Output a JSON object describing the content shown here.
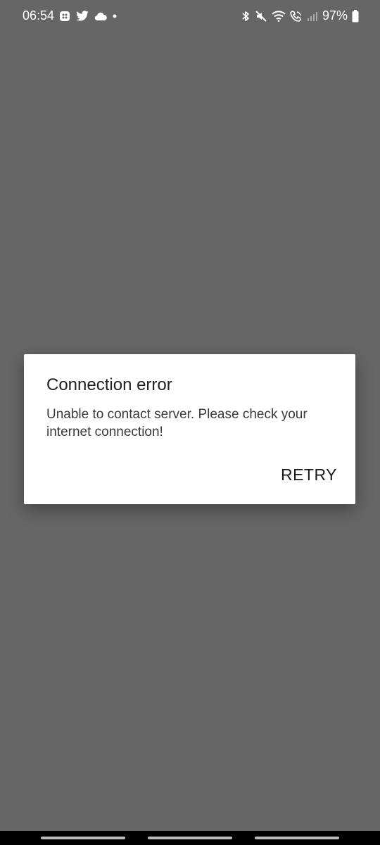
{
  "status_bar": {
    "time": "06:54",
    "battery_percent": "97%",
    "left_icons": [
      "dots-app-icon",
      "twitter-icon",
      "cloud-icon",
      "notification-dot-icon"
    ],
    "right_icons": [
      "bluetooth-icon",
      "mute-icon",
      "wifi-icon",
      "wifi-calling-icon",
      "signal-icon",
      "battery-icon"
    ]
  },
  "dialog": {
    "title": "Connection error",
    "message": "Unable to contact server. Please check your internet connection!",
    "retry_label": "RETRY"
  },
  "colors": {
    "background": "#666666",
    "dialog": "#ffffff",
    "text": "#212121"
  }
}
